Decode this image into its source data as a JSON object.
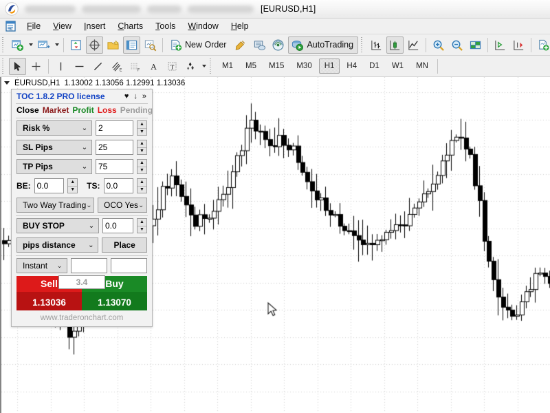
{
  "window": {
    "document_title": "[EURUSD,H1]",
    "redacted_blocks": [
      74,
      86,
      50,
      96
    ]
  },
  "menu": {
    "app_icon": "metaeditor-icon",
    "items": [
      {
        "label": "File",
        "accel": "F"
      },
      {
        "label": "View",
        "accel": "V"
      },
      {
        "label": "Insert",
        "accel": "I"
      },
      {
        "label": "Charts",
        "accel": "C"
      },
      {
        "label": "Tools",
        "accel": "T"
      },
      {
        "label": "Window",
        "accel": "W"
      },
      {
        "label": "Help",
        "accel": "H"
      }
    ]
  },
  "toolbar_main": {
    "new_chart": "new-chart-icon",
    "profiles": "profiles-icon",
    "market_watch": "market-watch-icon",
    "data_window": "data-window-icon",
    "navigator": "navigator-icon",
    "terminal": "terminal-icon",
    "strategy_tester": "strategy-tester-icon",
    "new_order_label": "New Order",
    "metaeditor": "metaeditor-icon",
    "mql5_community": "mql5-community-icon",
    "signals": "signals-icon",
    "autotrading_label": "AutoTrading",
    "bar_chart": "bar-chart-icon",
    "candlestick_chart": "candlestick-chart-icon",
    "line_chart": "line-chart-icon",
    "zoom_in": "zoom-in-icon",
    "zoom_out": "zoom-out-icon",
    "grid_tile": "tile-windows-icon",
    "chart_shift": "chart-shift-icon",
    "auto_scroll": "auto-scroll-icon",
    "indicators": "indicators-icon"
  },
  "toolbar_draw": {
    "cursor": "cursor-icon",
    "crosshair": "crosshair-icon",
    "vertical_line": "vertical-line-icon",
    "horizontal_line": "horizontal-line-icon",
    "trendline": "trendline-icon",
    "equidistant_channel": "equidistant-channel-icon",
    "fibonacci": "fibonacci-icon",
    "text": "text-icon",
    "text_label": "text-label-icon",
    "shapes": "shapes-icon",
    "timeframes": [
      "M1",
      "M5",
      "M15",
      "M30",
      "H1",
      "H4",
      "D1",
      "W1",
      "MN"
    ],
    "active_timeframe": "H1"
  },
  "chart": {
    "symbol_period": "EURUSD,H1",
    "ohlc": "1.13002 1.13056 1.12991 1.13036",
    "open": "1.13002",
    "high": "1.13056",
    "low": "1.12991",
    "close": "1.13036",
    "bg_color": "#ffffff",
    "grid_color": "#d0d0d0",
    "bull_body": "#ffffff",
    "bear_body": "#000000",
    "wick_color": "#000000"
  },
  "panel": {
    "title": "TOC 1.8.2 PRO license",
    "title_color": "#1142c4",
    "header_icons": [
      "heart-icon",
      "down-arrow-icon",
      "double-chevron-icon"
    ],
    "header_icon_glyphs": [
      "♥",
      "↓",
      "»"
    ],
    "tabs": [
      {
        "label": "Close",
        "color": "#000000"
      },
      {
        "label": "Market",
        "color": "#8b1a1a"
      },
      {
        "label": "Profit",
        "color": "#1a8a26"
      },
      {
        "label": "Loss",
        "color": "#e01b1b"
      },
      {
        "label": "Pending",
        "color": "#9c9c9c"
      }
    ],
    "rows": [
      {
        "select": "Risk %",
        "value": "2"
      },
      {
        "select": "SL Pips",
        "value": "25"
      },
      {
        "select": "TP Pips",
        "value": "75"
      }
    ],
    "be_label": "BE:",
    "be_value": "0.0",
    "ts_label": "TS:",
    "ts_value": "0.0",
    "mode_select": "Two Way Trading",
    "oco_select": "OCO Yes",
    "order_type_select": "BUY STOP",
    "order_type_value": "0.0",
    "distance_select": "pips distance",
    "place_button": "Place",
    "execution_select": "Instant",
    "lots_value": "",
    "comment_value": "",
    "sell_label": "Sell",
    "sell_price": "1.13036",
    "buy_label": "Buy",
    "buy_price": "1.13070",
    "spread": "3.4",
    "footer": "www.traderonchart.com",
    "sell_color": "#dd1a1a",
    "buy_color": "#1a8a26"
  }
}
